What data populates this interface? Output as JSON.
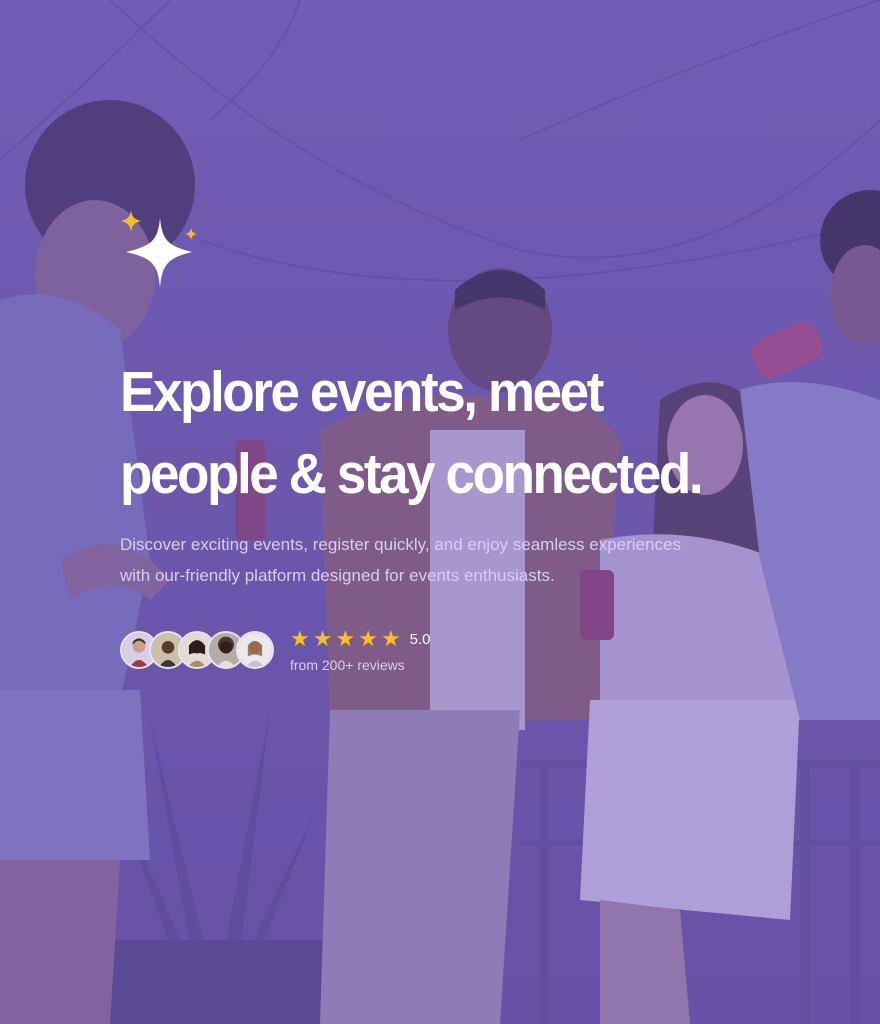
{
  "hero": {
    "headline_line1": "Explore events, meet",
    "headline_line2": "people & stay connected.",
    "subtext_line1": "Discover exciting events, register quickly, and enjoy seamless experiences",
    "subtext_line2": "with our-friendly platform designed for events enthusiasts.",
    "background": "photo of friends at a rooftop party with purple overlay"
  },
  "social_proof": {
    "avatar_count": 5,
    "rating": "5.0",
    "stars": 5,
    "reviews": "from 200+ reviews"
  },
  "colors": {
    "overlay": "#6c56b2",
    "headline": "#ffffff",
    "subtext": "#d9cdf6",
    "star": "#f7bd2c",
    "sparkle_large": "#ffffff",
    "sparkle_small": "#f7bd2c"
  },
  "icons": {
    "sparkle": "sparkle-icon",
    "star": "star-icon"
  }
}
